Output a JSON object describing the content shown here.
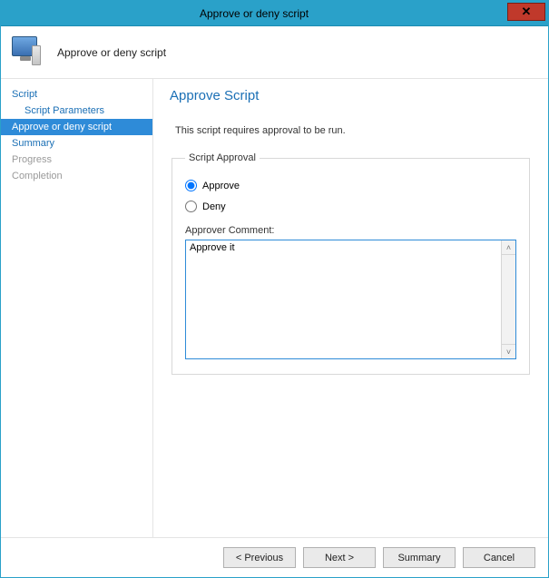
{
  "window": {
    "title": "Approve or deny script"
  },
  "header": {
    "title": "Approve or deny script"
  },
  "sidebar": {
    "steps": [
      {
        "label": "Script",
        "indent": false,
        "selected": false,
        "disabled": false
      },
      {
        "label": "Script Parameters",
        "indent": true,
        "selected": false,
        "disabled": false
      },
      {
        "label": "Approve or deny script",
        "indent": false,
        "selected": true,
        "disabled": false
      },
      {
        "label": "Summary",
        "indent": false,
        "selected": false,
        "disabled": false
      },
      {
        "label": "Progress",
        "indent": false,
        "selected": false,
        "disabled": true
      },
      {
        "label": "Completion",
        "indent": false,
        "selected": false,
        "disabled": true
      }
    ]
  },
  "content": {
    "heading": "Approve Script",
    "subtext": "This script requires approval to be run.",
    "groupLegend": "Script Approval",
    "approveLabel": "Approve",
    "denyLabel": "Deny",
    "approvalSelected": "approve",
    "commentLabel": "Approver Comment:",
    "commentValue": "Approve it"
  },
  "footer": {
    "previous": "< Previous",
    "next": "Next >",
    "summary": "Summary",
    "cancel": "Cancel"
  }
}
